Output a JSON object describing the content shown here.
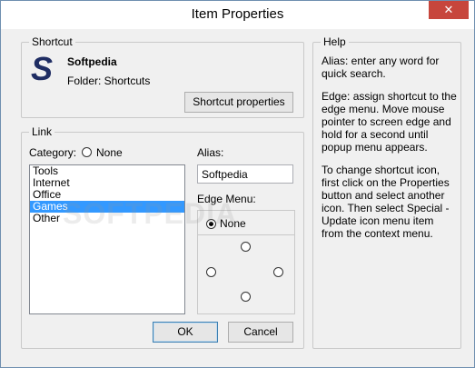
{
  "window": {
    "title": "Item Properties",
    "close_glyph": "✕"
  },
  "shortcut": {
    "group_label": "Shortcut",
    "icon": "softpedia-s-logo",
    "name": "Softpedia",
    "folder": "Folder: Shortcuts",
    "properties_button": "Shortcut properties"
  },
  "link": {
    "group_label": "Link",
    "category_label": "Category:",
    "none_label": "None",
    "categories": [
      "Tools",
      "Internet",
      "Office",
      "Games",
      "Other"
    ],
    "selected_category": "Games",
    "alias_label": "Alias:",
    "alias_value": "Softpedia",
    "edge_menu_label": "Edge Menu:",
    "edge_none_label": "None"
  },
  "help": {
    "group_label": "Help",
    "paragraphs": [
      "Alias: enter any word for quick search.",
      "Edge: assign shortcut to the edge menu. Move mouse pointer to screen edge and hold for a second until popup menu appears.",
      "To change shortcut icon, first click on the Properties button and select another icon. Then select Special - Update icon menu item from the context menu."
    ]
  },
  "buttons": {
    "ok": "OK",
    "cancel": "Cancel"
  },
  "watermark": "SOFTPEDIA"
}
